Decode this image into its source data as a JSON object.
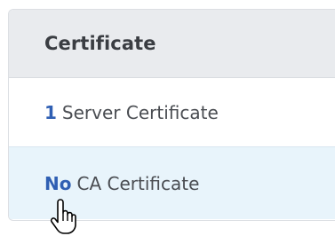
{
  "panel": {
    "title": "Certificate",
    "rows": [
      {
        "count": "1",
        "label": "Server Certificate"
      },
      {
        "count": "No",
        "label": "CA Certificate"
      }
    ]
  },
  "colors": {
    "header_bg": "#e9ebee",
    "count_accent": "#2f5fb3",
    "hover_row_bg": "#e8f4fb"
  },
  "icons": {
    "cursor": "hand-pointer-icon"
  }
}
